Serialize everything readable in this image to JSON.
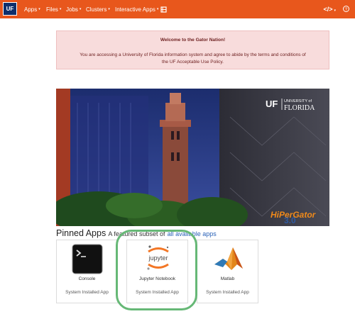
{
  "navbar": {
    "logo": "UF",
    "menus": [
      {
        "label": "Apps"
      },
      {
        "label": "Files"
      },
      {
        "label": "Jobs"
      },
      {
        "label": "Clusters"
      },
      {
        "label": "Interactive Apps"
      }
    ],
    "dev_label": "</>",
    "colors": {
      "bar": "#e8571c"
    }
  },
  "alert": {
    "title": "Welcome to the Gator Nation!",
    "body": "You are accessing a University of Florida information system and agree to abide by the terms and conditions of the UF Acceptable Use Policy."
  },
  "hero": {
    "uf_mark": "UF",
    "university_line1": "UNIVERSITY of",
    "university_line2": "FLORIDA",
    "brand": "HiPerGator",
    "brand_version": "3.0"
  },
  "pinned": {
    "heading": "Pinned Apps",
    "subtitle_prefix": "A featured subset of",
    "subtitle_link": "all available apps",
    "apps": [
      {
        "name": "Console",
        "category": "System Installed App",
        "icon": "terminal-icon"
      },
      {
        "name": "Jupyter Notebook",
        "category": "System Installed App",
        "icon": "jupyter-icon",
        "logo_text": "jupyter"
      },
      {
        "name": "Matlab",
        "category": "System Installed App",
        "icon": "matlab-icon"
      }
    ]
  }
}
